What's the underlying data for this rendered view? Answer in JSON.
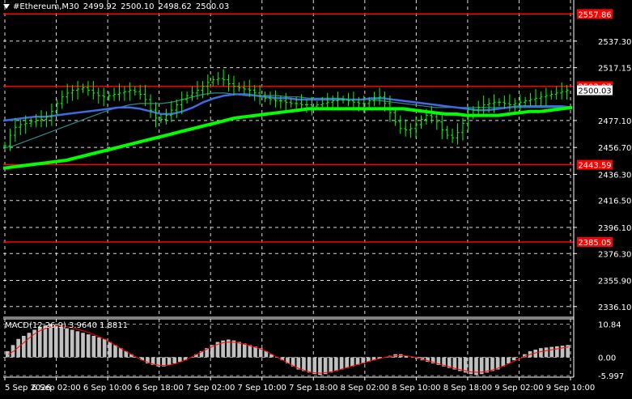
{
  "header": {
    "symbol": "#Ethereum,M30",
    "open": "2499.92",
    "high": "2500.10",
    "low": "2498.62",
    "close": "2500.03"
  },
  "macd_header": {
    "label": "MACD(12,26,9)",
    "value1": "3.9640",
    "value2": "1.8811"
  },
  "colors": {
    "background": "#000000",
    "candles": "#00ff00",
    "grid": "#ffffff",
    "sr_line": "#ff0000",
    "ma_slow": "#00ff00",
    "ma_mid": "#4169e1",
    "ma_fast": "#2e8b8b",
    "macd_hist": "#c0c0c0",
    "macd_signal": "#ff0000",
    "price_label_bg": "#ff0000"
  },
  "chart_data": [
    {
      "type": "line",
      "title": "#Ethereum,M30",
      "ylim": [
        2336.1,
        2557.86
      ],
      "y_ticks": [
        "2537.30",
        "2517.15",
        "2477.10",
        "2456.70",
        "2436.30",
        "2416.50",
        "2396.10",
        "2376.30",
        "2355.90",
        "2336.10"
      ],
      "y_tick_values": [
        2537.3,
        2517.15,
        2477.1,
        2456.7,
        2436.3,
        2416.5,
        2396.1,
        2376.3,
        2355.9,
        2336.1
      ],
      "x_ticks": [
        "5 Sep 2026",
        "6 Sep 02:00",
        "6 Sep 10:00",
        "6 Sep 18:00",
        "7 Sep 02:00",
        "7 Sep 10:00",
        "7 Sep 18:00",
        "8 Sep 02:00",
        "8 Sep 10:00",
        "8 Sep 18:00",
        "9 Sep 02:00",
        "9 Sep 10:00"
      ],
      "current_price": "2500.03",
      "current_price_value": 2500.03,
      "levels": [
        {
          "label": "2557.86",
          "value": 2557.86
        },
        {
          "label": "2503.07",
          "value": 2503.07
        },
        {
          "label": "2443.59",
          "value": 2443.59
        },
        {
          "label": "2385.05",
          "value": 2385.05
        }
      ],
      "series": [
        {
          "kind": "price",
          "values": [
            2458,
            2466,
            2472,
            2474,
            2475,
            2476,
            2477,
            2478,
            2480,
            2484,
            2490,
            2495,
            2498,
            2500,
            2501,
            2502,
            2500,
            2498,
            2496,
            2495,
            2496,
            2497,
            2498,
            2499,
            2500,
            2499,
            2497,
            2493,
            2485,
            2479,
            2478,
            2481,
            2485,
            2489,
            2493,
            2496,
            2498,
            2500,
            2503,
            2506,
            2508,
            2509,
            2508,
            2505,
            2503,
            2502,
            2501,
            2500,
            2498,
            2496,
            2494,
            2493,
            2492,
            2492,
            2491,
            2490,
            2490,
            2489,
            2489,
            2488,
            2489,
            2490,
            2491,
            2492,
            2493,
            2493,
            2492,
            2491,
            2490,
            2490,
            2492,
            2494,
            2495,
            2490,
            2483,
            2476,
            2471,
            2470,
            2471,
            2474,
            2478,
            2481,
            2480,
            2476,
            2470,
            2466,
            2464,
            2468,
            2475,
            2481,
            2485,
            2487,
            2489,
            2490,
            2491,
            2491,
            2490,
            2489,
            2490,
            2491,
            2492,
            2493,
            2494,
            2495,
            2496,
            2497,
            2498,
            2499,
            2500
          ]
        },
        {
          "kind": "ma_slow",
          "values": [
            2441,
            2442,
            2443,
            2444,
            2445,
            2446,
            2447,
            2449,
            2451,
            2453,
            2455,
            2457,
            2459,
            2461,
            2463,
            2465,
            2467,
            2469,
            2471,
            2473,
            2475,
            2477,
            2479,
            2480,
            2481,
            2482,
            2483,
            2484,
            2485,
            2486,
            2486,
            2486,
            2486,
            2486,
            2486,
            2486,
            2486,
            2486,
            2486,
            2485,
            2484,
            2483,
            2482,
            2482,
            2481,
            2481,
            2481,
            2481,
            2482,
            2483,
            2484,
            2484,
            2485,
            2486,
            2487
          ]
        },
        {
          "kind": "ma_mid",
          "values": [
            2477,
            2478,
            2479,
            2480,
            2480,
            2481,
            2482,
            2483,
            2484,
            2485,
            2486,
            2487,
            2487,
            2486,
            2484,
            2482,
            2482,
            2484,
            2487,
            2491,
            2494,
            2496,
            2497,
            2497,
            2496,
            2495,
            2494,
            2494,
            2493,
            2493,
            2493,
            2493,
            2493,
            2493,
            2493,
            2494,
            2494,
            2493,
            2492,
            2491,
            2490,
            2489,
            2488,
            2487,
            2486,
            2485,
            2485,
            2486,
            2487,
            2488,
            2488,
            2488,
            2488,
            2488,
            2487
          ]
        },
        {
          "kind": "ma_fast",
          "values": [
            2456,
            2458,
            2461,
            2464,
            2467,
            2470,
            2473,
            2476,
            2479,
            2482,
            2485,
            2487,
            2489,
            2490,
            2490,
            2490,
            2491,
            2493,
            2495,
            2497,
            2498,
            2498,
            2497,
            2496,
            2496,
            2496,
            2496,
            2495,
            2495,
            2494,
            2494,
            2494,
            2494,
            2493,
            2493,
            2493,
            2492,
            2491,
            2490,
            2489,
            2488,
            2487,
            2487,
            2487,
            2487,
            2487,
            2487,
            2487,
            2487,
            2487,
            2487,
            2487,
            2487,
            2487,
            2487
          ]
        }
      ]
    },
    {
      "type": "bar",
      "title": "MACD(12,26,9)",
      "ylim": [
        -6.5,
        11.5
      ],
      "y_ticks": [
        "10.84",
        "0.00",
        "-5.997"
      ],
      "y_tick_values": [
        10.84,
        0.0,
        -5.997
      ],
      "series": [
        {
          "name": "histogram",
          "values": [
            2,
            4,
            6,
            7,
            8,
            9,
            10,
            10.5,
            10.8,
            10.6,
            10,
            9.5,
            9,
            8.5,
            8,
            7.5,
            7,
            6.5,
            6,
            5,
            4,
            3,
            2,
            1,
            0,
            -1,
            -2,
            -2.5,
            -3,
            -3,
            -2.5,
            -2,
            -1.5,
            -1,
            0,
            1,
            2,
            3,
            4,
            5,
            5.5,
            5.8,
            5.5,
            5,
            4.5,
            4,
            3.5,
            3,
            2,
            1,
            0,
            -1,
            -2,
            -3,
            -4,
            -4.5,
            -5,
            -5.5,
            -5.8,
            -5.5,
            -5,
            -4.5,
            -4,
            -3.5,
            -3,
            -2.5,
            -2,
            -1.5,
            -1,
            -0.5,
            0,
            0.5,
            1,
            1,
            0.5,
            0,
            -0.5,
            -1,
            -1.5,
            -2,
            -2.5,
            -3,
            -3.5,
            -4,
            -4.5,
            -5,
            -5.5,
            -5.8,
            -5.5,
            -5,
            -4.5,
            -4,
            -3,
            -2,
            -1,
            0,
            1,
            2,
            2.5,
            3,
            3.2,
            3.4,
            3.6,
            3.8,
            4
          ]
        },
        {
          "name": "signal",
          "values": [
            1,
            2,
            3.5,
            5,
            6.5,
            7.8,
            8.8,
            9.5,
            10,
            10.3,
            10.3,
            10,
            9.6,
            9.1,
            8.6,
            8,
            7.3,
            6.6,
            5.8,
            4.8,
            3.8,
            2.8,
            1.8,
            0.8,
            -0.2,
            -1.1,
            -1.8,
            -2.3,
            -2.6,
            -2.7,
            -2.5,
            -2.1,
            -1.5,
            -0.8,
            0.1,
            1,
            1.9,
            2.8,
            3.6,
            4.3,
            4.8,
            5,
            4.9,
            4.6,
            4.2,
            3.7,
            3.2,
            2.6,
            1.8,
            0.9,
            -0.1,
            -1,
            -2,
            -2.9,
            -3.7,
            -4.3,
            -4.8,
            -5.1,
            -5.2,
            -5,
            -4.7,
            -4.3,
            -3.8,
            -3.3,
            -2.8,
            -2.3,
            -1.8,
            -1.3,
            -0.8,
            -0.4,
            0,
            0.3,
            0.5,
            0.6,
            0.5,
            0.2,
            -0.2,
            -0.7,
            -1.2,
            -1.7,
            -2.2,
            -2.7,
            -3.2,
            -3.7,
            -4.1,
            -4.5,
            -4.8,
            -4.9,
            -4.8,
            -4.5,
            -4.1,
            -3.5,
            -2.8,
            -2,
            -1.2,
            -0.4,
            0.4,
            1,
            1.5,
            1.9,
            2.2,
            2.5,
            2.8,
            3.1,
            3.4
          ]
        }
      ]
    }
  ]
}
